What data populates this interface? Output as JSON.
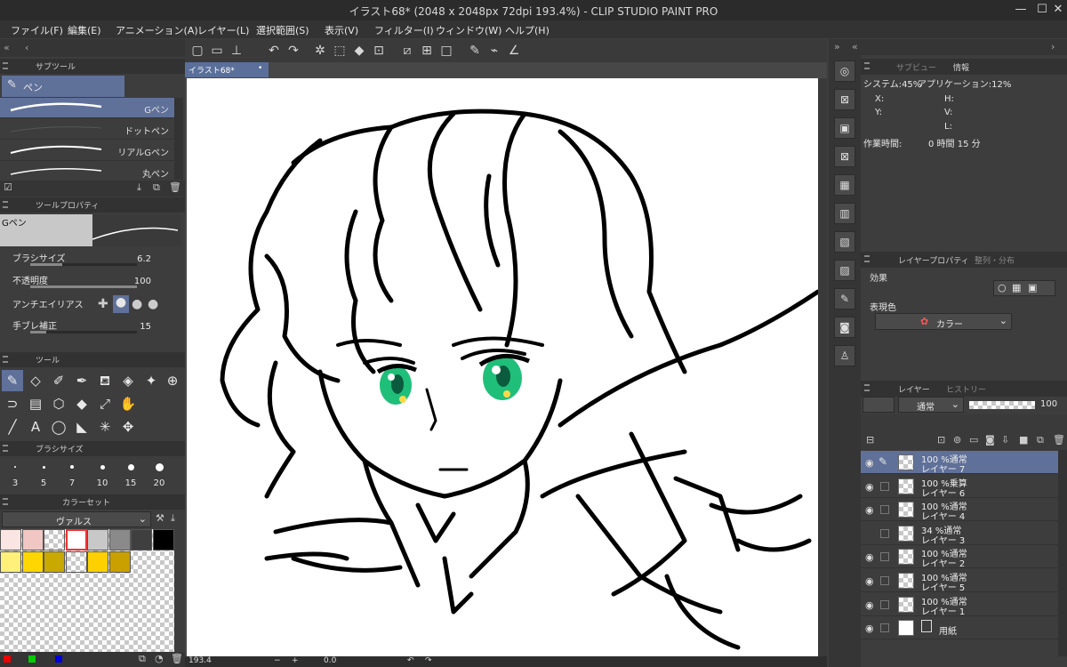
{
  "app": {
    "title": "イラスト68* (2048 x 2048px 72dpi 193.4%)  - CLIP STUDIO PAINT PRO",
    "window_controls": {
      "minimize": "—",
      "maximize": "☐",
      "close": "✕"
    }
  },
  "menu": [
    "ファイル(F)",
    "編集(E)",
    "アニメーション(A)",
    "レイヤー(L)",
    "選択範囲(S)",
    "表示(V)",
    "フィルター(I)",
    "ウィンドウ(W)",
    "ヘルプ(H)"
  ],
  "toolbar_icons": [
    "new-icon",
    "open-icon",
    "save-icon",
    "undo-icon",
    "redo-icon",
    "clear-icon",
    "select-icon",
    "fill-icon",
    "transform-icon",
    "deselect-icon",
    "invert-icon",
    "border-icon",
    "pen-icon",
    "brush-icon",
    "ruler-icon"
  ],
  "subtool": {
    "panel_title": "サブツール",
    "group": "ペン",
    "brushes": [
      "Gペン",
      "ドットペン",
      "リアルGペン",
      "丸ペン"
    ],
    "selected": "Gペン"
  },
  "tool_property": {
    "panel_title": "ツールプロパティ",
    "preview_name": "Gペン",
    "rows": [
      {
        "label": "ブラシサイズ",
        "value": "6.2",
        "fill": 0.3
      },
      {
        "label": "不透明度",
        "value": "100",
        "fill": 1.0
      },
      {
        "label": "アンチエイリアス",
        "value": ""
      },
      {
        "label": "手ブレ補正",
        "value": "15",
        "fill": 0.15
      }
    ]
  },
  "tools_panel": {
    "panel_title": "ツール"
  },
  "brush_size": {
    "panel_title": "ブラシサイズ",
    "sizes": [
      "3",
      "5",
      "7",
      "10",
      "15",
      "20"
    ]
  },
  "color_set": {
    "panel_title": "カラーセット",
    "set_name": "ヴァルス",
    "swatches": [
      "#fbe5e2",
      "#f0c7c3",
      "transparent",
      "#ffffff",
      "#c8c8c8",
      "#8a8a8a",
      "#3f3f3f",
      "#000000",
      "#fff07a",
      "#ffd700",
      "#c9a800",
      "transparent",
      "#ffd000",
      "#c9a000"
    ]
  },
  "document": {
    "tab": "イラスト68*",
    "status": {
      "zoom": "193.4",
      "angle": "0.0"
    }
  },
  "info_panel": {
    "tabs": [
      "サブビュー",
      "情報"
    ],
    "system": "システム:45%",
    "app_usage": "アプリケーション:12%",
    "coords": [
      "X:",
      "Y:",
      "H:",
      "V:",
      "L:"
    ],
    "work_time_label": "作業時間:",
    "work_time": "0 時間 15 分"
  },
  "layer_property": {
    "tabs": [
      "レイヤープロパティ",
      "整列・分布"
    ],
    "effect_label": "効果",
    "color_label": "表現色",
    "color_value": "カラー"
  },
  "layer_panel": {
    "tabs": [
      "レイヤー",
      "ヒストリー"
    ],
    "blend_mode": "通常",
    "opacity": "100",
    "layers": [
      {
        "mode": "100 %通常",
        "name": "レイヤー 7",
        "selected": true
      },
      {
        "mode": "100 %乗算",
        "name": "レイヤー 6"
      },
      {
        "mode": "100 %通常",
        "name": "レイヤー 4"
      },
      {
        "mode": "34 %通常",
        "name": "レイヤー 3"
      },
      {
        "mode": "100 %通常",
        "name": "レイヤー 2"
      },
      {
        "mode": "100 %通常",
        "name": "レイヤー 5"
      },
      {
        "mode": "100 %通常",
        "name": "レイヤー 1"
      },
      {
        "mode": "",
        "name": "用紙"
      }
    ]
  },
  "colors": {
    "accent": "#5f7099",
    "eye_green": "#1fbf7a",
    "panel_bg": "#3d3d3d"
  }
}
